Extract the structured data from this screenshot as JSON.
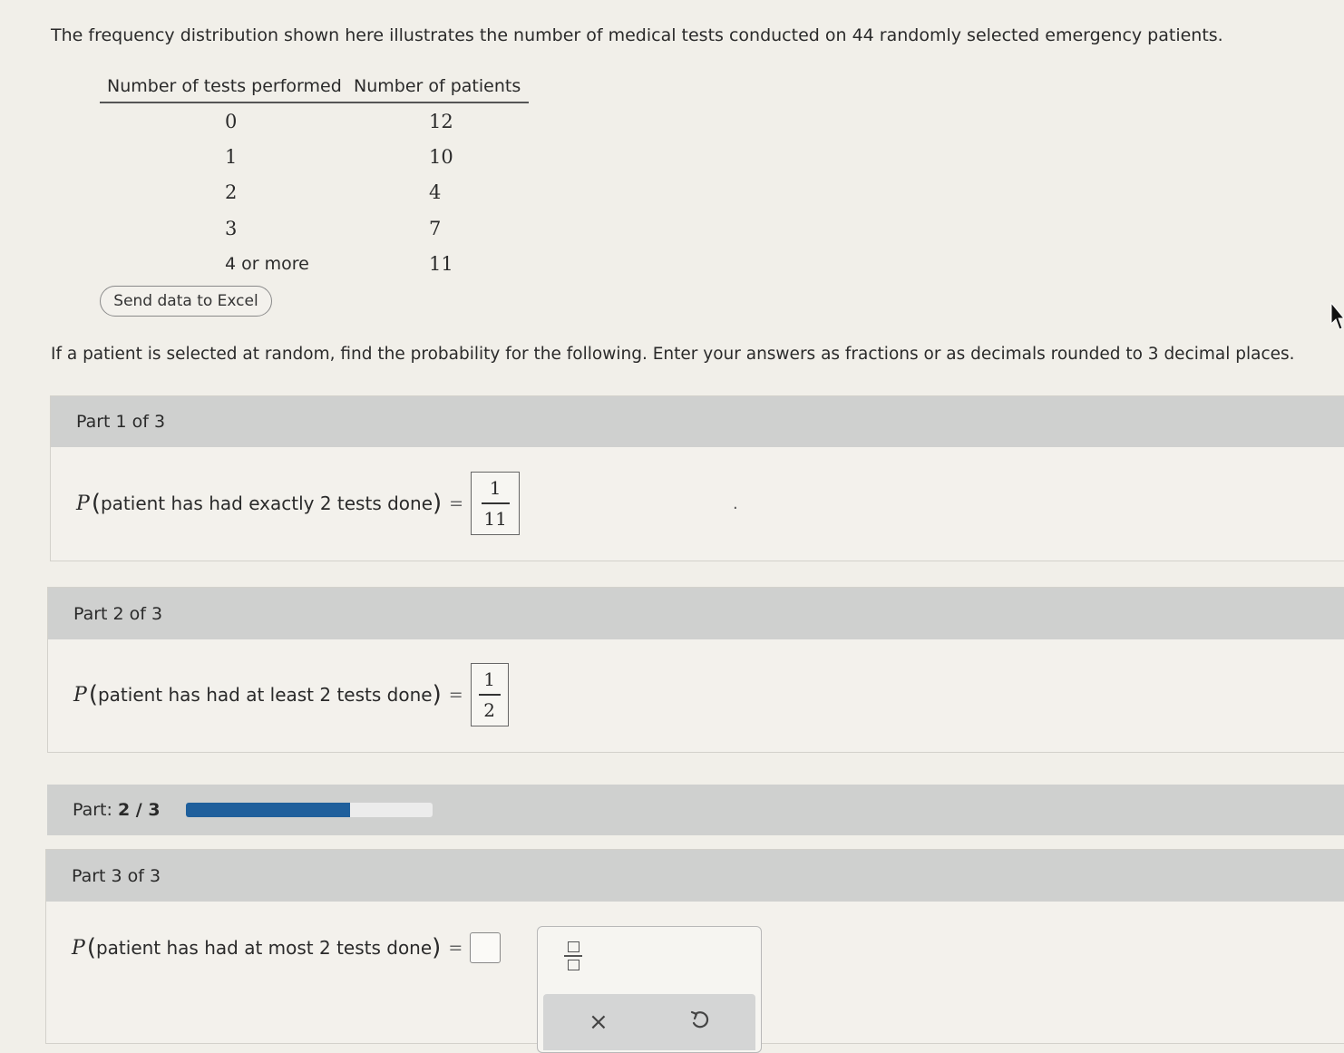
{
  "intro": "The frequency distribution shown here illustrates the number of medical tests conducted on 44 randomly selected emergency patients.",
  "table": {
    "headers": [
      "Number of tests performed",
      "Number of patients"
    ],
    "rows": [
      [
        "0",
        "12"
      ],
      [
        "1",
        "10"
      ],
      [
        "2",
        "4"
      ],
      [
        "3",
        "7"
      ],
      [
        "4 or more",
        "11"
      ]
    ]
  },
  "excel_button": "Send data to Excel",
  "instructions": "If a patient is selected at random, find the probability for the following. Enter your answers as fractions or as decimals rounded to 3 decimal places.",
  "parts": [
    {
      "header": "Part 1 of 3",
      "p_letter": "P",
      "question": "patient has had exactly 2 tests done",
      "equals": "=",
      "answer_numerator": "1",
      "answer_denominator": "11",
      "trailing": "."
    },
    {
      "header": "Part 2 of 3",
      "p_letter": "P",
      "question": "patient has had at least 2 tests done",
      "equals": "=",
      "answer_numerator": "1",
      "answer_denominator": "2"
    },
    {
      "header": "Part 3 of 3",
      "p_letter": "P",
      "question": "patient has had at most 2 tests done",
      "equals": "="
    }
  ],
  "progress": {
    "label": "Part:",
    "value_text": "2 / 3",
    "fraction": 0.667,
    "fill_color": "#1f5f9c"
  },
  "toolbox": {
    "fraction_icon": "fraction-icon",
    "clear_icon": "close-icon",
    "undo_icon": "undo-icon",
    "clear_glyph": "×"
  }
}
